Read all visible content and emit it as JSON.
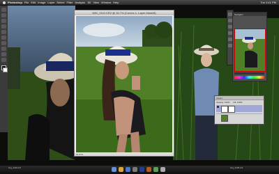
{
  "menubar": {
    "apple": "",
    "app": "Photoshop",
    "menus": [
      "File",
      "Edit",
      "Image",
      "Layer",
      "Select",
      "Filter",
      "Analysis",
      "3D",
      "View",
      "Window",
      "Help"
    ],
    "clock": "Tue 3:41 PM"
  },
  "document": {
    "title": "IMG_2110.CR2 @ 16.7% (Curves 1, Layer Mask/8)",
    "status": "16.67%"
  },
  "panels": {
    "navigator_label": "Navigator",
    "layers_label": "Layers",
    "opacity_label": "Opacity:",
    "opacity_value": "100%",
    "fill_label": "Fill:",
    "fill_value": "100%"
  },
  "dock": {
    "label_left": "img_2110.cr2",
    "label_right": "img_2109.cr2"
  },
  "icons": [
    "apple-icon",
    "move-tool-icon",
    "marquee-tool-icon",
    "lasso-tool-icon",
    "crop-tool-icon",
    "brush-tool-icon",
    "eraser-tool-icon",
    "gradient-tool-icon",
    "type-tool-icon",
    "hand-tool-icon",
    "zoom-tool-icon",
    "foreground-color-icon",
    "background-color-icon",
    "layer-thumbnail-icon",
    "eye-icon"
  ],
  "colors": {
    "menubar": "#3a3a3a",
    "panel_dark": "#505050",
    "panel_light": "#d6d6d6",
    "grass": "#3f6a1f",
    "hat_band": "#1c2f8a",
    "sky": "#9fb8cc"
  }
}
